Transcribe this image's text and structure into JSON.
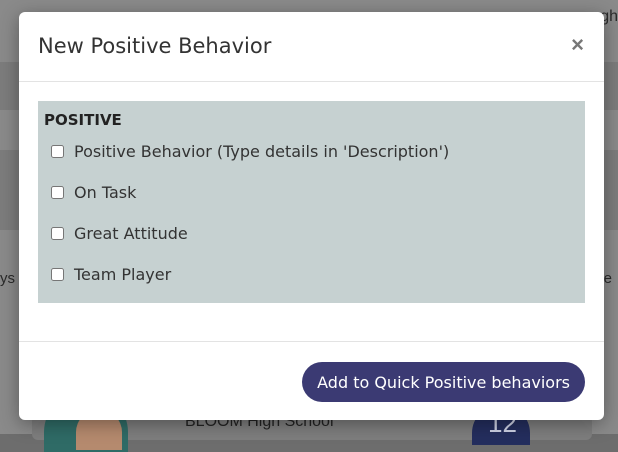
{
  "background": {
    "top_right_fragment": "gh",
    "left_fragment": "ys",
    "right_fragment": "e",
    "school_name": "BLOOM High School"
  },
  "modal": {
    "title": "New Positive Behavior",
    "close_glyph": "×",
    "section_heading": "POSITIVE",
    "options": [
      {
        "label": "Positive Behavior (Type details in 'Description')",
        "checked": false
      },
      {
        "label": "On Task",
        "checked": false
      },
      {
        "label": "Great Attitude",
        "checked": false
      },
      {
        "label": "Team Player",
        "checked": false
      }
    ],
    "primary_button": "Add to Quick Positive behaviors"
  },
  "colors": {
    "panel": "#c6d1d1",
    "button": "#3b3a73"
  }
}
